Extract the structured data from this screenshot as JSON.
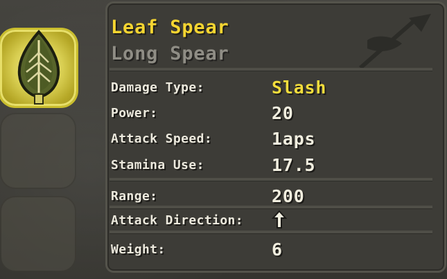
{
  "item": {
    "name": "Leaf Spear",
    "type": "Long Spear",
    "icon": "leaf-spear-icon"
  },
  "stats": [
    {
      "label": "Damage Type:",
      "value": "Slash"
    },
    {
      "label": "Power:",
      "value": "20"
    },
    {
      "label": "Attack Speed:",
      "value": "1aps"
    },
    {
      "label": "Stamina Use:",
      "value": "17.5"
    },
    {
      "label": "Range:",
      "value": "200"
    },
    {
      "label": "Attack Direction:",
      "icon": "up-arrow-icon"
    },
    {
      "label": "Weight:",
      "value": "6"
    }
  ],
  "colors": {
    "title": "#f5d531",
    "subtitle": "#8f8d85",
    "accent_value": "#f3dd3c",
    "panel_bg": "#3d3c37"
  }
}
